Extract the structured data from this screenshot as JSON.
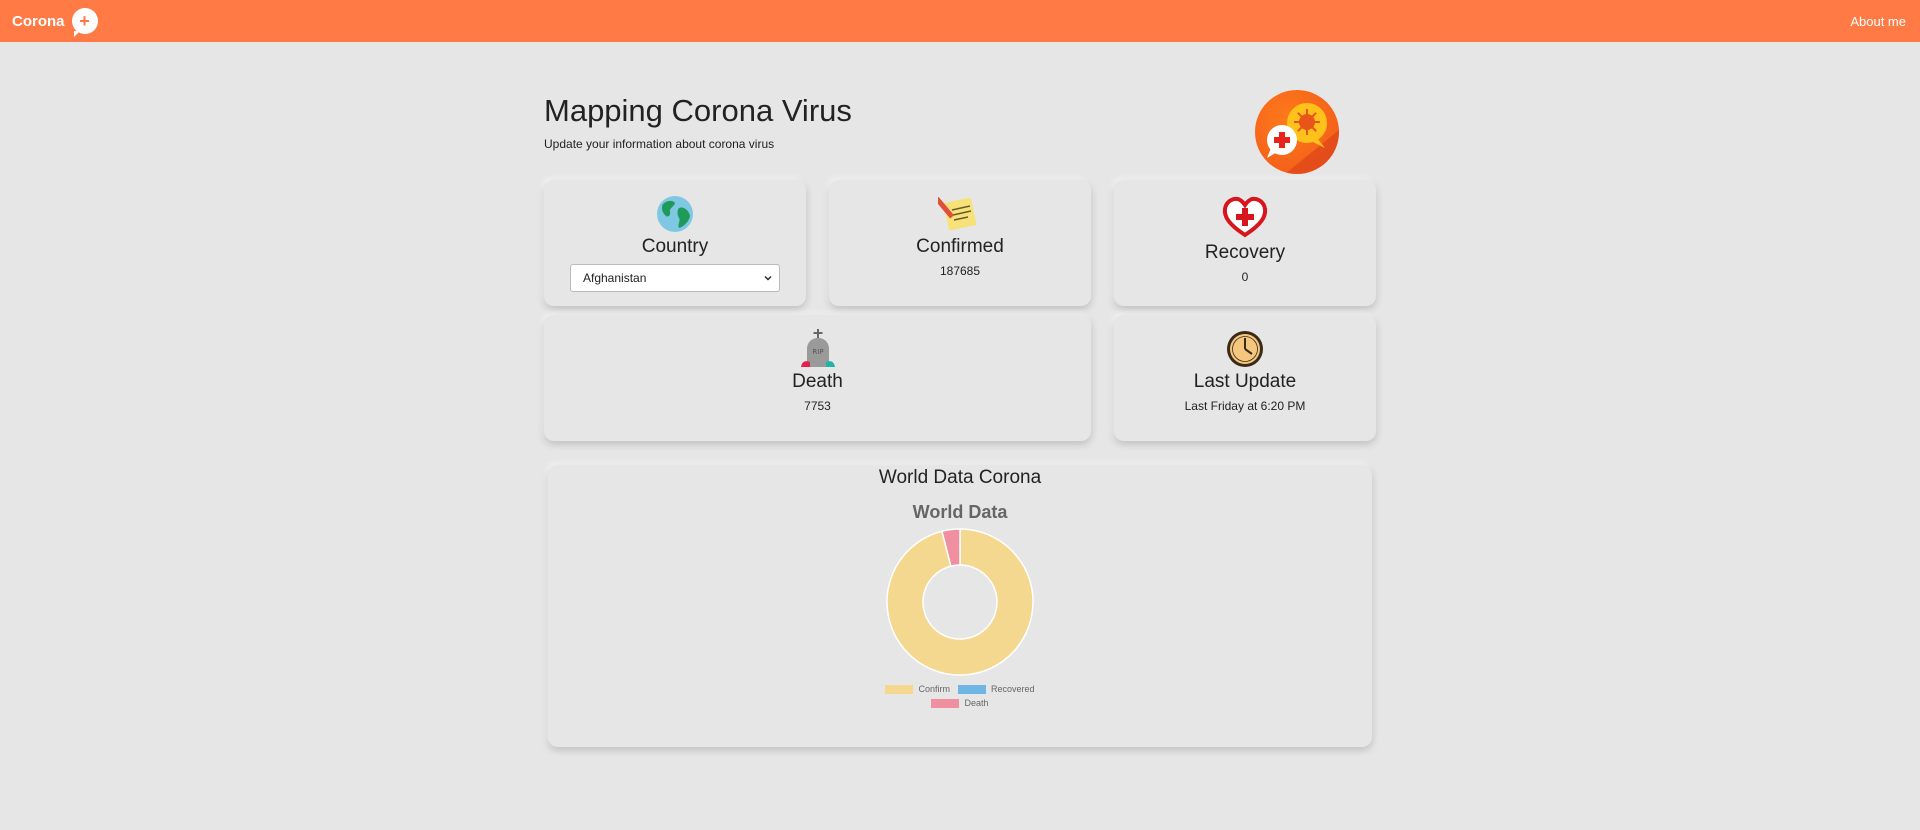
{
  "nav": {
    "brand": "Corona",
    "about": "About me"
  },
  "header": {
    "title": "Mapping Corona Virus",
    "subtitle": "Update your information about corona virus"
  },
  "cards": {
    "country": {
      "label": "Country",
      "selected": "Afghanistan"
    },
    "confirmed": {
      "label": "Confirmed",
      "value": "187685"
    },
    "recovery": {
      "label": "Recovery",
      "value": "0"
    },
    "death": {
      "label": "Death",
      "value": "7753"
    },
    "last_update": {
      "label": "Last Update",
      "value": "Last Friday at 6:20 PM"
    }
  },
  "chart_section": {
    "heading": "World Data Corona"
  },
  "chart_data": {
    "type": "pie",
    "title": "World Data",
    "categories": [
      "Confirm",
      "Recovered",
      "Death"
    ],
    "values": [
      187685,
      0,
      7753
    ],
    "colors": [
      "#f5d88f",
      "#6fb5e6",
      "#f08fa0"
    ]
  },
  "icons": {
    "brand": "plus-speech-bubble-icon",
    "hero": "virus-chat-bubbles-icon",
    "country": "globe-icon",
    "confirmed": "note-pencil-icon",
    "recovery": "heart-cross-icon",
    "death": "tombstone-icon",
    "last_update": "clock-icon",
    "select": "chevron-down-icon"
  }
}
